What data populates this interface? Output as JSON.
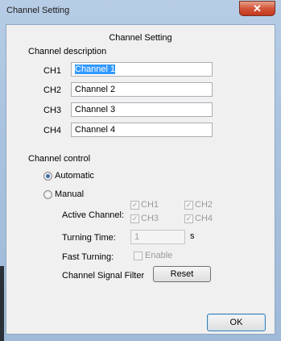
{
  "window": {
    "title": "Channel Setting",
    "close_glyph": "✕"
  },
  "header": {
    "title": "Channel Setting"
  },
  "description": {
    "section_label": "Channel description",
    "channels": [
      {
        "label": "CH1",
        "value": "Channel 1"
      },
      {
        "label": "CH2",
        "value": "Channel 2"
      },
      {
        "label": "CH3",
        "value": "Channel 3"
      },
      {
        "label": "CH4",
        "value": "Channel 4"
      }
    ]
  },
  "control": {
    "section_label": "Channel control",
    "automatic_label": "Automatic",
    "manual_label": "Manual",
    "mode": "Automatic",
    "active_channel_label": "Active Channel:",
    "active_checks": [
      {
        "label": "CH1",
        "checked": true
      },
      {
        "label": "CH2",
        "checked": true
      },
      {
        "label": "CH3",
        "checked": true
      },
      {
        "label": "CH4",
        "checked": true
      }
    ],
    "turning_time_label": "Turning Time:",
    "turning_time_value": "1",
    "turning_time_unit": "s",
    "fast_turning_label": "Fast Turning:",
    "enable_label": "Enable",
    "enable_checked": false,
    "signal_filter_label": "Channel Signal Filter",
    "reset_label": "Reset"
  },
  "footer": {
    "ok_label": "OK"
  },
  "colors": {
    "accent": "#3399ff",
    "title_bar": "#a9c2df",
    "close": "#c4371c"
  }
}
